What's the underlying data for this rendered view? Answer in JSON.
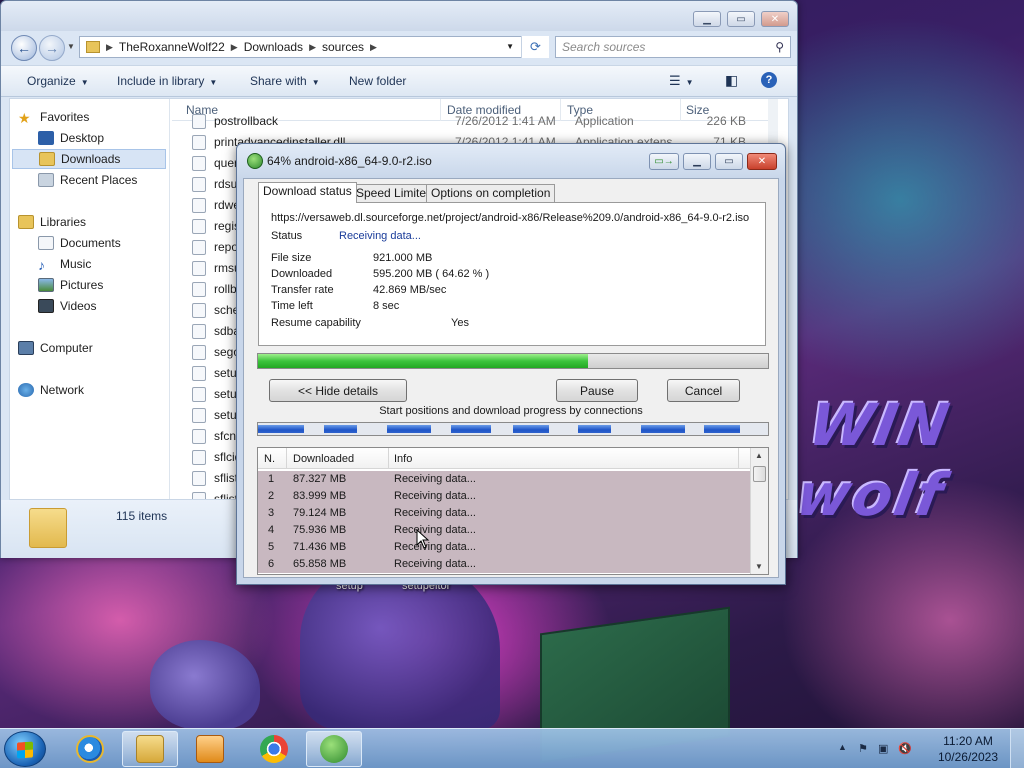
{
  "desktop": {
    "icon_labels": [
      "setup",
      "setupeitor"
    ]
  },
  "explorer": {
    "address": {
      "segments": [
        "TheRoxanneWolf22",
        "Downloads",
        "sources"
      ]
    },
    "search_placeholder": "Search sources",
    "toolbar": {
      "organize": "Organize",
      "include_in_library": "Include in library",
      "share_with": "Share with",
      "new_folder": "New folder"
    },
    "nav": {
      "favorites": "Favorites",
      "desktop": "Desktop",
      "downloads": "Downloads",
      "recent_places": "Recent Places",
      "libraries": "Libraries",
      "documents": "Documents",
      "music": "Music",
      "pictures": "Pictures",
      "videos": "Videos",
      "computer": "Computer",
      "network": "Network"
    },
    "columns": {
      "name": "Name",
      "date_modified": "Date modified",
      "type": "Type",
      "size": "Size"
    },
    "files": [
      {
        "name": "postrollback",
        "date": "7/26/2012 1:41 AM",
        "type": "Application",
        "size": "226 KB"
      },
      {
        "name": "printadvancedinstaller.dll",
        "date": "7/26/2012 1:41 AM",
        "type": "Application extens",
        "size": "71 KB"
      },
      {
        "name": "query",
        "date": "",
        "type": "",
        "size": ""
      },
      {
        "name": "rdsup",
        "date": "",
        "type": "",
        "size": ""
      },
      {
        "name": "rdweb",
        "date": "",
        "type": "",
        "size": ""
      },
      {
        "name": "regist",
        "date": "",
        "type": "",
        "size": ""
      },
      {
        "name": "report",
        "date": "",
        "type": "",
        "size": ""
      },
      {
        "name": "rmsup",
        "date": "",
        "type": "",
        "size": ""
      },
      {
        "name": "rollba",
        "date": "",
        "type": "",
        "size": ""
      },
      {
        "name": "schem",
        "date": "",
        "type": "",
        "size": ""
      },
      {
        "name": "sdbap",
        "date": "",
        "type": "",
        "size": ""
      },
      {
        "name": "segoe",
        "date": "",
        "type": "",
        "size": ""
      },
      {
        "name": "setuin",
        "date": "",
        "type": "",
        "size": ""
      },
      {
        "name": "setup",
        "date": "",
        "type": "",
        "size": ""
      },
      {
        "name": "setup",
        "date": "",
        "type": "",
        "size": ""
      },
      {
        "name": "sfcn.c",
        "date": "",
        "type": "",
        "size": ""
      },
      {
        "name": "sflcid.",
        "date": "",
        "type": "",
        "size": ""
      },
      {
        "name": "sflistll",
        "date": "",
        "type": "",
        "size": ""
      },
      {
        "name": "sflistw",
        "date": "",
        "type": "",
        "size": ""
      }
    ],
    "item_count": "115 items"
  },
  "idm": {
    "title": "64% android-x86_64-9.0-r2.iso",
    "tabs": [
      "Download status",
      "Speed Limiter",
      "Options on completion"
    ],
    "url": "https://versaweb.dl.sourceforge.net/project/android-x86/Release%209.0/android-x86_64-9.0-r2.iso",
    "status_label": "Status",
    "status_value": "Receiving data...",
    "file_size_label": "File size",
    "file_size_value": "921.000  MB",
    "downloaded_label": "Downloaded",
    "downloaded_value": "595.200  MB  ( 64.62 % )",
    "transfer_rate_label": "Transfer rate",
    "transfer_rate_value": "42.869  MB/sec",
    "time_left_label": "Time left",
    "time_left_value": "8 sec",
    "resume_label": "Resume capability",
    "resume_value": "Yes",
    "progress_fraction": 0.6462,
    "buttons": {
      "hide_details": "<< Hide details",
      "pause": "Pause",
      "cancel": "Cancel"
    },
    "connections_caption": "Start positions and download progress by connections",
    "connection_segments": [
      {
        "start": 0.0,
        "progress": 0.09
      },
      {
        "start": 0.13,
        "progress": 0.065
      },
      {
        "start": 0.253,
        "progress": 0.087
      },
      {
        "start": 0.378,
        "progress": 0.078
      },
      {
        "start": 0.5,
        "progress": 0.07
      },
      {
        "start": 0.627,
        "progress": 0.065
      },
      {
        "start": 0.75,
        "progress": 0.087
      },
      {
        "start": 0.875,
        "progress": 0.07
      }
    ],
    "list_columns": {
      "n": "N.",
      "downloaded": "Downloaded",
      "info": "Info"
    },
    "connections": [
      {
        "n": "1",
        "downloaded": "87.327  MB",
        "info": "Receiving data..."
      },
      {
        "n": "2",
        "downloaded": "83.999  MB",
        "info": "Receiving data..."
      },
      {
        "n": "3",
        "downloaded": "79.124  MB",
        "info": "Receiving data..."
      },
      {
        "n": "4",
        "downloaded": "75.936  MB",
        "info": "Receiving data..."
      },
      {
        "n": "5",
        "downloaded": "71.436  MB",
        "info": "Receiving data..."
      },
      {
        "n": "6",
        "downloaded": "65.858  MB",
        "info": "Receiving data..."
      }
    ]
  },
  "taskbar": {
    "time": "11:20 AM",
    "date": "10/26/2023"
  }
}
